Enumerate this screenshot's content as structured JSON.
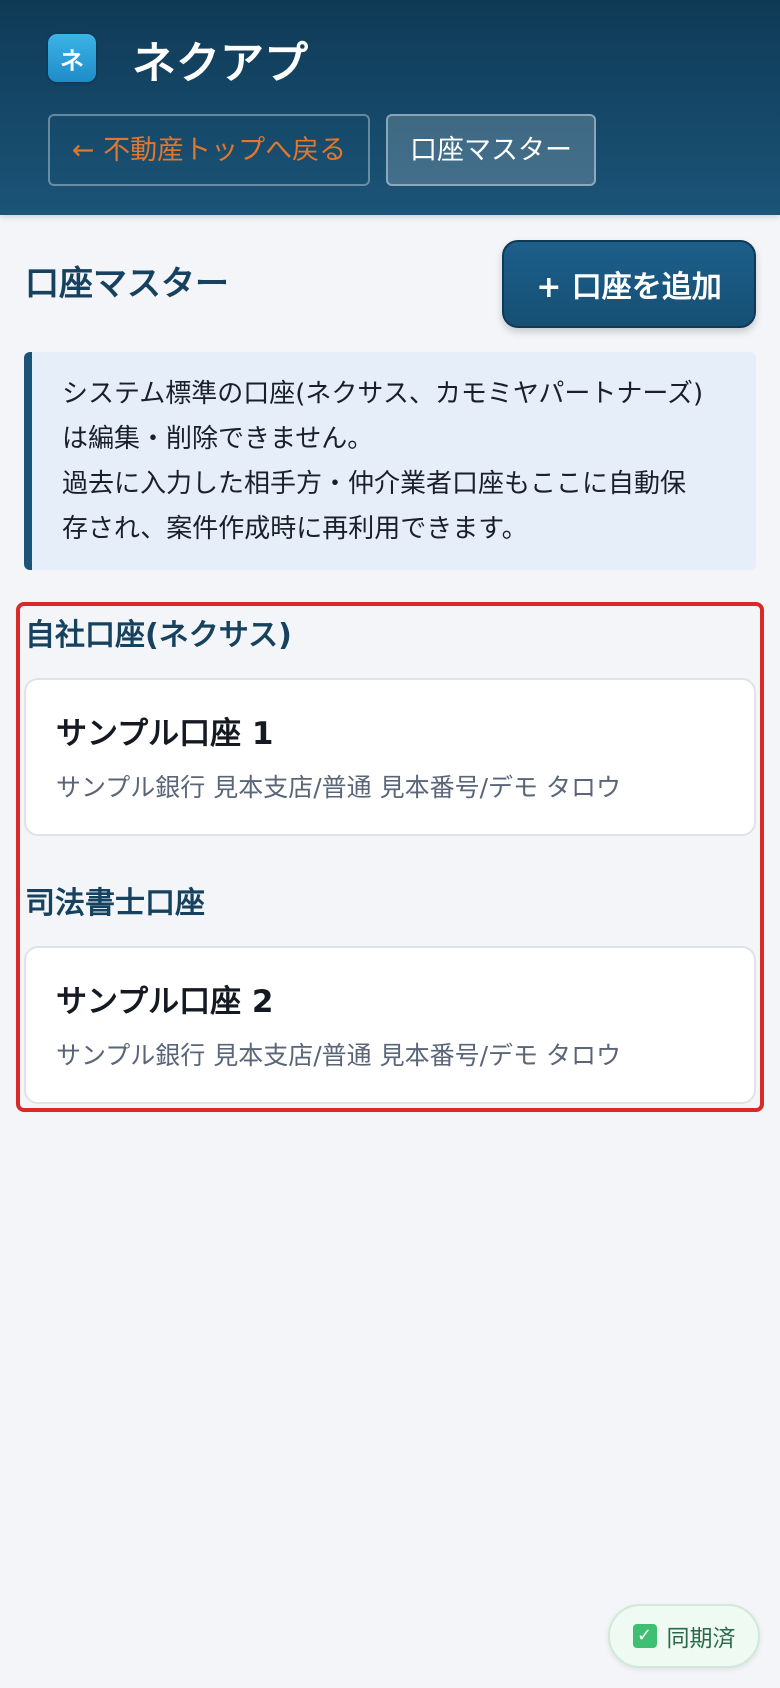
{
  "header": {
    "logo_glyph": "ネ",
    "app_title": "ネクアプ",
    "nav": {
      "back_label": "← 不動産トップへ戻る",
      "current_label": "口座マスター"
    }
  },
  "main": {
    "page_title": "口座マスター",
    "add_button_label": "+ 口座を追加",
    "info_lines": [
      "システム標準の口座(ネクサス、カモミヤパートナーズ)",
      "は編集・削除できません。",
      "過去に入力した相手方・仲介業者口座もここに自動保",
      "存され、案件作成時に再利用できます。"
    ],
    "sections": [
      {
        "title": "自社口座(ネクサス)",
        "accounts": [
          {
            "name": "サンプル口座 1",
            "detail": "サンプル銀行 見本支店/普通 見本番号/デモ タロウ"
          }
        ]
      },
      {
        "title": "司法書士口座",
        "accounts": [
          {
            "name": "サンプル口座 2",
            "detail": "サンプル銀行 見本支店/普通 見本番号/デモ タロウ"
          }
        ]
      }
    ]
  },
  "status": {
    "sync_label": "同期済",
    "sync_icon": "check-icon"
  },
  "colors": {
    "header_bg": "#0f3a56",
    "accent": "#1b5478",
    "back_link": "#e2762a",
    "highlight_border": "#d92929",
    "sync_check": "#3fbf72"
  }
}
